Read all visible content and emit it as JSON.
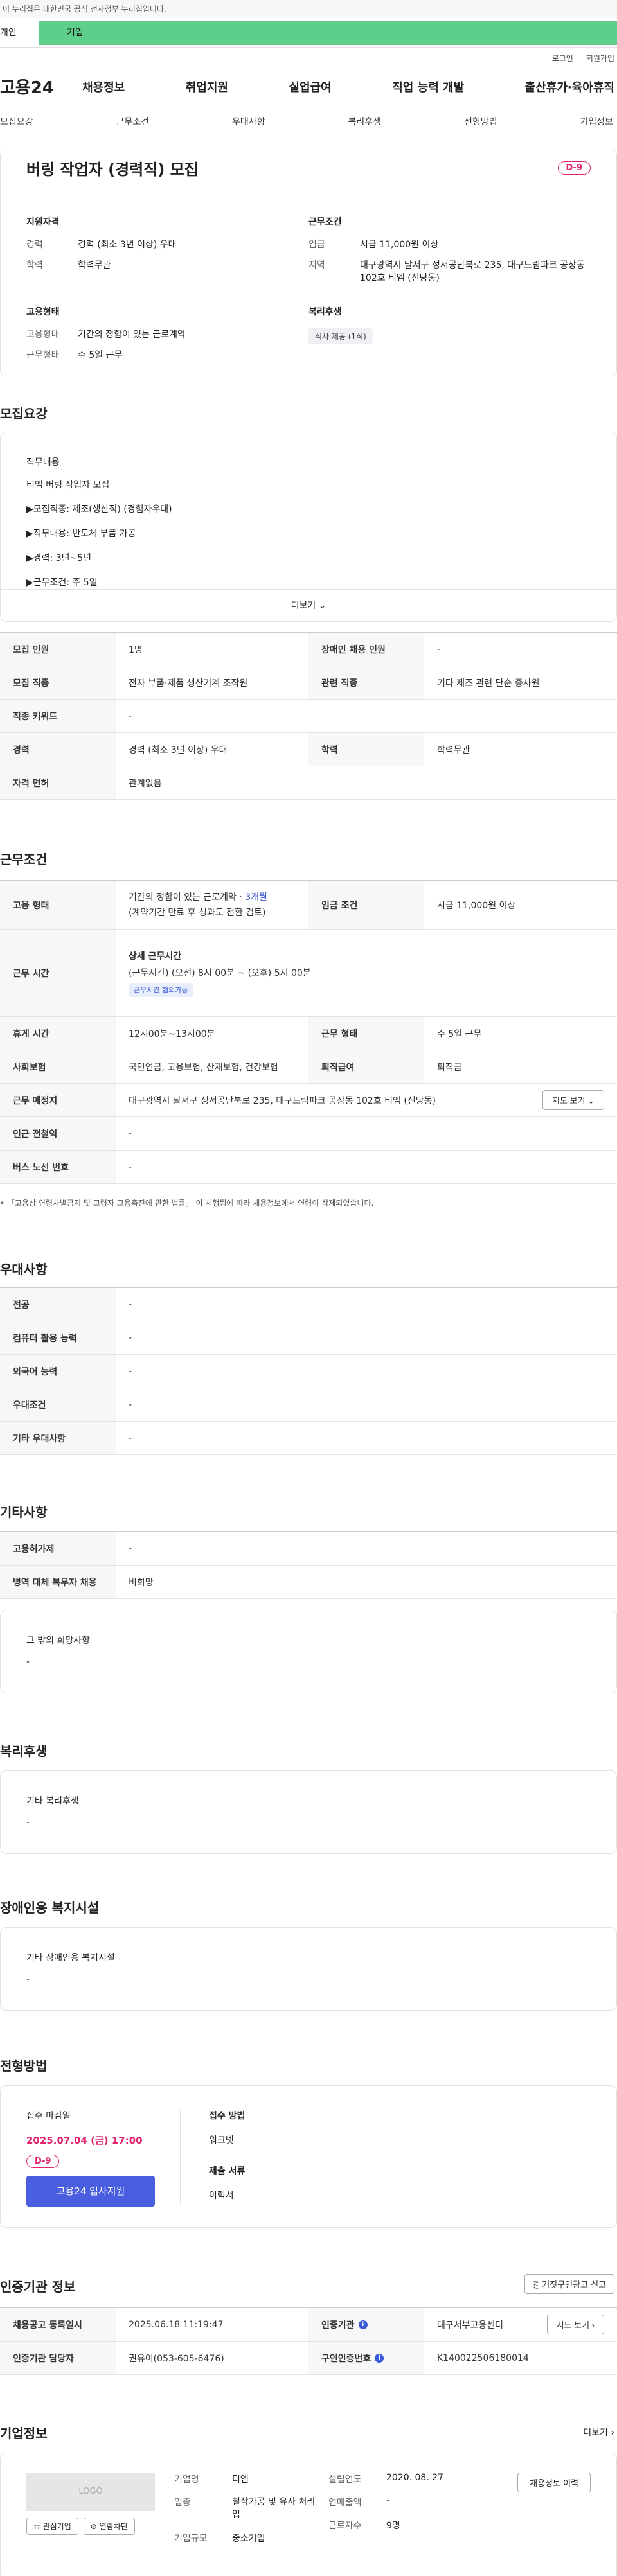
{
  "gov_banner": "이 누리집은 대한민국 공식 전자정부 누리집입니다.",
  "user_tabs": {
    "person": "개인",
    "company": "기업"
  },
  "util": {
    "login": "로그인",
    "join": "회원가입"
  },
  "logo": "고용24",
  "gnb": [
    "채용정보",
    "취업지원",
    "실업급여",
    "직업 능력 개발",
    "출산휴가·육아휴직"
  ],
  "subtabs": [
    "모집요강",
    "근무조건",
    "우대사항",
    "복리후생",
    "전형방법",
    "기업정보"
  ],
  "summary": {
    "title": "버링 작업자 (경력직) 모집",
    "dday": "D-9",
    "recruit": {
      "heading": "지원자격",
      "rows": [
        {
          "k": "경력",
          "v": "경력 (최소 3년 이상) 우대"
        },
        {
          "k": "학력",
          "v": "학력무관"
        }
      ]
    },
    "work": {
      "heading": "근무조건",
      "rows": [
        {
          "k": "임금",
          "v": "시급 11,000원 이상"
        },
        {
          "k": "지역",
          "v": "대구광역시 달서구 성서공단북로 235, 대구드림파크 공장동 102호 티엠 (신당동)"
        }
      ]
    },
    "employ": {
      "heading": "고용형태",
      "rows": [
        {
          "k": "고용형태",
          "v": "기간의 정함이 있는 근로계약"
        },
        {
          "k": "근무형태",
          "v": "주 5일 근무"
        }
      ]
    },
    "welfare": {
      "heading": "복리후생",
      "badge": "식사 제공 (1식)"
    }
  },
  "s_recruit": {
    "title": "모집요강",
    "duty_h": "직무내용",
    "duty_lines": [
      "티엠 버링 작업자 모집",
      "▶모집직종: 제조(생산직) (경험자우대)",
      "▶직무내용: 반도체 부품 가공",
      "▶경력: 3년~5년",
      "▶근무조건: 주 5일"
    ],
    "more": "더보기",
    "rows": [
      [
        {
          "k": "모집 인원",
          "v": "1명"
        },
        {
          "k": "장애인 채용 인원",
          "v": "-"
        }
      ],
      [
        {
          "k": "모집 직종",
          "v": "전자 부품·제품 생산기계 조작원"
        },
        {
          "k": "관련 직종",
          "v": "기타 제조 관련 단순 종사원"
        }
      ],
      [
        {
          "k": "직종 키워드",
          "v": "-"
        }
      ],
      [
        {
          "k": "경력",
          "v": "경력 (최소 3년 이상) 우대"
        },
        {
          "k": "학력",
          "v": "학력무관"
        }
      ],
      [
        {
          "k": "자격 면허",
          "v": "관계없음"
        }
      ]
    ]
  },
  "s_work": {
    "title": "근무조건",
    "emp_k": "고용 형태",
    "emp_v1": "기간의 정함이 있는 근로계약 · ",
    "emp_v1b": "3개월",
    "emp_v2": "(계약기간 만료 후 성과도 전환 검토)",
    "pay_k": "임금 조건",
    "pay_v": "시급 11,000원 이상",
    "time_k": "근무 시간",
    "time_h": "상세 근무시간",
    "time_v": "(근무시간) (오전) 8시 00분 ~ (오후) 5시 00분",
    "time_badge": "근무시간 협의가능",
    "rows": [
      [
        {
          "k": "휴게 시간",
          "v": "12시00분~13시00분"
        },
        {
          "k": "근무 형태",
          "v": "주 5일 근무"
        }
      ],
      [
        {
          "k": "사회보험",
          "v": "국민연금, 고용보험, 산재보험, 건강보험"
        },
        {
          "k": "퇴직급여",
          "v": "퇴직금"
        }
      ]
    ],
    "loc_k": "근무 예정지",
    "loc_v": "대구광역시 달서구 성서공단북로 235, 대구드림파크 공장동 102호 티엠 (신당동)",
    "map": "지도 보기",
    "rows2": [
      {
        "k": "인근 전철역",
        "v": "-"
      },
      {
        "k": "버스 노선 번호",
        "v": "-"
      }
    ],
    "notice": "「고용상 연령차별금지 및 고령자 고용촉진에 관한 법률」 이 시행됨에 따라 채용정보에서 연령이 삭제되었습니다."
  },
  "s_pref": {
    "title": "우대사항",
    "rows": [
      {
        "k": "전공",
        "v": "-"
      },
      {
        "k": "컴퓨터 활용 능력",
        "v": "-"
      },
      {
        "k": "외국어 능력",
        "v": "-"
      },
      {
        "k": "우대조건",
        "v": "-"
      },
      {
        "k": "기타 우대사항",
        "v": "-"
      }
    ]
  },
  "s_etc": {
    "title": "기타사항",
    "rows": [
      {
        "k": "고용허가제",
        "v": "-"
      },
      {
        "k": "병역 대체 복무자 채용",
        "v": "비희망"
      }
    ],
    "box_h": "그 밖의 희망사항",
    "box_v": "-"
  },
  "s_welfare": {
    "title": "복리후생",
    "box_h": "기타 복리후생",
    "box_v": "-"
  },
  "s_disabled": {
    "title": "장애인용 복지시설",
    "box_h": "기타 장애인용 복지시설",
    "box_v": "-"
  },
  "s_process": {
    "title": "전형방법",
    "deadline_h": "접수 마감일",
    "deadline_v": "2025.07.04 (금) 17:00",
    "dday": "D-9",
    "apply": "고용24 입사지원",
    "method_h": "접수 방법",
    "method_v": "워크넷",
    "docs_h": "제출 서류",
    "docs_v": "이력서"
  },
  "s_auth": {
    "title": "인증기관 정보",
    "report": "거짓구인광고 신고",
    "r1": [
      {
        "k": "채용공고 등록일시",
        "v": "2025.06.18 11:19:47"
      },
      {
        "k": "인증기관",
        "v": "대구서부고용센터"
      }
    ],
    "map": "지도 보기",
    "r2": [
      {
        "k": "인증기관 담당자",
        "v": "권유이(053-605-6476)"
      },
      {
        "k": "구인인증번호",
        "v": "K140022506180014"
      }
    ]
  },
  "s_company": {
    "title": "기업정보",
    "more": "더보기",
    "logo": "LOGO",
    "fav": "관심기업",
    "block": "열람차단",
    "c1": [
      {
        "k": "기업명",
        "v": "티엠"
      },
      {
        "k": "업종",
        "v": "철삭가공 및 유사 처리업"
      },
      {
        "k": "기업규모",
        "v": "중소기업"
      }
    ],
    "c2": [
      {
        "k": "설립연도",
        "v": "2020. 08. 27"
      },
      {
        "k": "연매출액",
        "v": "-"
      },
      {
        "k": "근로자수",
        "v": "9명"
      }
    ],
    "jobs": "채용정보 이력"
  }
}
